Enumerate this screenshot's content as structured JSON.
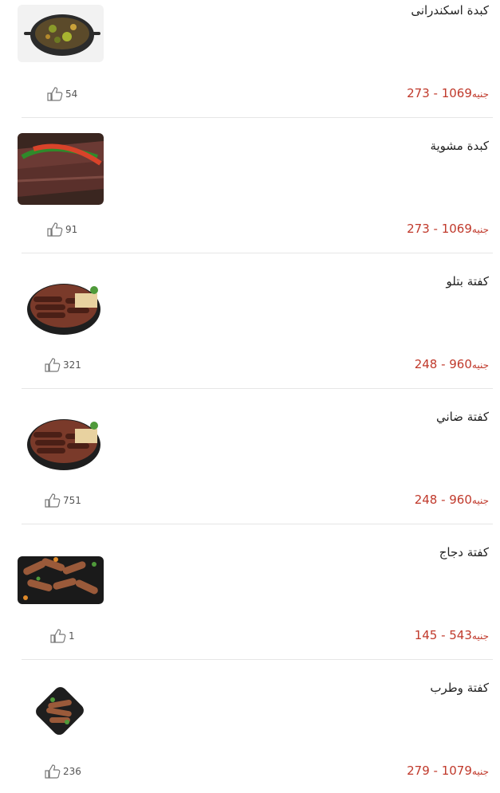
{
  "currency": "جنيه",
  "items": [
    {
      "name": "كبدة اسكندرانى",
      "price_range": "273 - 1069",
      "likes": "54",
      "image": "alexandrian-liver-dish"
    },
    {
      "name": "كبدة مشوية",
      "price_range": "273 - 1069",
      "likes": "91",
      "image": "grilled-liver-dish"
    },
    {
      "name": "كفتة بتلو",
      "price_range": "248 - 960",
      "likes": "321",
      "image": "veal-kofta-plate"
    },
    {
      "name": "كفتة ضاني",
      "price_range": "248 - 960",
      "likes": "751",
      "image": "lamb-kofta-plate"
    },
    {
      "name": "كفتة دجاج",
      "price_range": "145 - 543",
      "likes": "1",
      "image": "chicken-kofta-tray"
    },
    {
      "name": "كفتة وطرب",
      "price_range": "279 - 1079",
      "likes": "236",
      "image": "kofta-tarb-plate"
    }
  ]
}
